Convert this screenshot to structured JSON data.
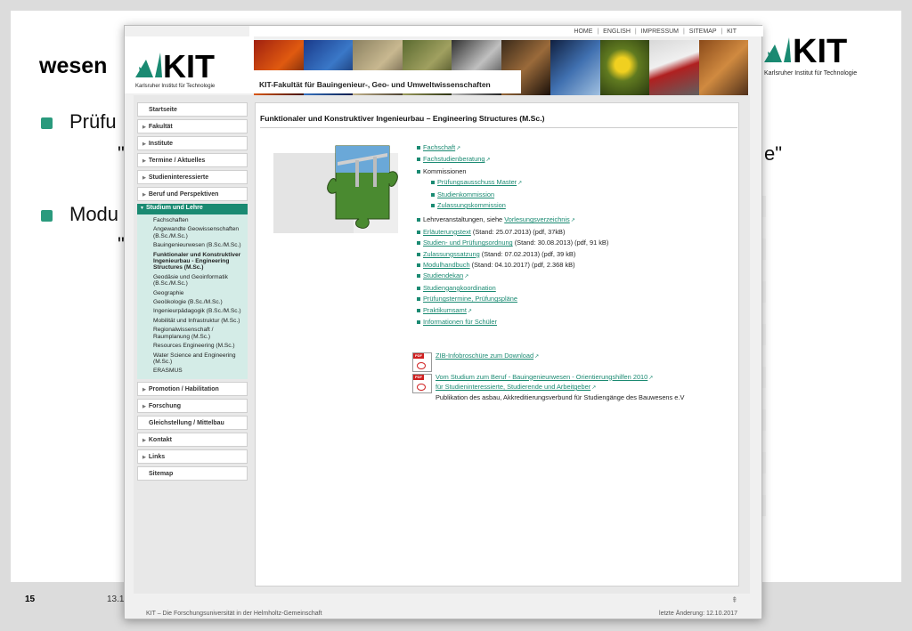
{
  "slide": {
    "title": "wesen",
    "bullet1": "Prüfu",
    "bullet1_cont": "\"",
    "bullet1_tail": "e\"",
    "bullet2": "Modu",
    "bullet2_cont": "\"",
    "page": "15",
    "date": "13.1",
    "logo_text": "KIT",
    "logo_sub": "Karlsruher Institut für Technologie"
  },
  "browser": {
    "topnav": [
      "HOME",
      "ENGLISH",
      "IMPRESSUM",
      "SITEMAP",
      "KIT"
    ],
    "logo_text": "KIT",
    "logo_sub": "Karlsruher Institut für Technologie",
    "faculty": "KIT-Fakultät für Bauingenieur-, Geo- und Umweltwissenschaften",
    "footer_left": "KIT – Die Forschungsuniversität in der Helmholtz-Gemeinschaft",
    "footer_right": "letzte Änderung: 12.10.2017"
  },
  "sidebar": {
    "items": [
      {
        "label": "Startseite",
        "arrow": false
      },
      {
        "label": "Fakultät",
        "arrow": true
      },
      {
        "label": "Institute",
        "arrow": true
      },
      {
        "label": "Termine / Aktuelles",
        "arrow": true
      },
      {
        "label": "Studieninteressierte",
        "arrow": true
      },
      {
        "label": "Beruf und Perspektiven",
        "arrow": true
      }
    ],
    "active": "Studium und Lehre",
    "sub_items": [
      "Fachschaften",
      "Angewandte Geowissenschaften (B.Sc./M.Sc.)",
      "Bauingenieurwesen (B.Sc./M.Sc.)",
      "Funktionaler und Konstruktiver Ingenieurbau - Engineering Structures (M.Sc.)",
      "Geodäsie und Geoinformatik (B.Sc./M.Sc.)",
      "Geographie",
      "Geoökologie (B.Sc./M.Sc.)",
      "Ingenieurpädagogik (B.Sc./M.Sc.)",
      "Mobilität und Infrastruktur (M.Sc.)",
      "Regionalwissenschaft / Raumplanung (M.Sc.)",
      "Resources Engineering (M.Sc.)",
      "Water Science and Engineering (M.Sc.)",
      "ERASMUS"
    ],
    "items_after": [
      {
        "label": "Promotion / Habilitation",
        "arrow": true
      },
      {
        "label": "Forschung",
        "arrow": true
      },
      {
        "label": "Gleichstellung / Mittelbau",
        "arrow": false
      },
      {
        "label": "Kontakt",
        "arrow": true
      },
      {
        "label": "Links",
        "arrow": true
      },
      {
        "label": "Sitemap",
        "arrow": false
      }
    ]
  },
  "main": {
    "title": "Funktionaler und Konstruktiver Ingenieurbau – Engineering Structures (M.Sc.)",
    "links": [
      {
        "parts": [
          {
            "t": "Fachschaft",
            "link": true
          }
        ],
        "ext": true
      },
      {
        "parts": [
          {
            "t": "Fachstudienberatung",
            "link": true
          }
        ],
        "ext": true
      },
      {
        "parts": [
          {
            "t": "Kommissionen",
            "link": false
          }
        ],
        "ext": false
      },
      {
        "parts": [
          {
            "t": "Prüfungsausschuss Master",
            "link": true
          }
        ],
        "ext": true,
        "sub": true
      },
      {
        "parts": [
          {
            "t": "Studienkommission",
            "link": true
          }
        ],
        "ext": false,
        "sub": true
      },
      {
        "parts": [
          {
            "t": "Zulassungskommission",
            "link": true
          }
        ],
        "ext": false,
        "sub": true
      },
      {
        "parts": [
          {
            "t": "Lehrveranstaltungen, siehe ",
            "link": false
          },
          {
            "t": "Vorlesungsverzeichnis",
            "link": true
          }
        ],
        "ext": true,
        "gap": true
      },
      {
        "parts": [
          {
            "t": "Erläuterungstext",
            "link": true
          },
          {
            "t": " (Stand: 25.07.2013) (pdf, 37kB)",
            "link": false
          }
        ],
        "ext": false
      },
      {
        "parts": [
          {
            "t": "Studien- und Prüfungsordnung",
            "link": true
          },
          {
            "t": " (Stand: 30.08.2013) (pdf, 91 kB)",
            "link": false
          }
        ],
        "ext": false
      },
      {
        "parts": [
          {
            "t": "Zulassungssatzung",
            "link": true
          },
          {
            "t": " (Stand: 07.02.2013) (pdf, 39 kB)",
            "link": false
          }
        ],
        "ext": false
      },
      {
        "parts": [
          {
            "t": "Modulhandbuch",
            "link": true
          },
          {
            "t": " (Stand: 04.10.2017) (pdf, 2.368 kB)",
            "link": false
          }
        ],
        "ext": false
      },
      {
        "parts": [
          {
            "t": "Studiendekan",
            "link": true
          }
        ],
        "ext": true
      },
      {
        "parts": [
          {
            "t": "Studiengangkoordination",
            "link": true
          }
        ],
        "ext": false
      },
      {
        "parts": [
          {
            "t": "Prüfungstermine, Prüfungspläne",
            "link": true
          }
        ],
        "ext": false
      },
      {
        "parts": [
          {
            "t": "Praktikumsamt",
            "link": true
          }
        ],
        "ext": true
      },
      {
        "parts": [
          {
            "t": "Informationen für Schüler",
            "link": true
          }
        ],
        "ext": false
      }
    ],
    "pdf1": "ZIB-Infobroschüre zum Download",
    "pdf2_line1": "Vom Studium zum Beruf - Bauingenieurwesen - Orientierungshilfen 2010",
    "pdf2_line2": "für Studieninteressierte, Studierende und Arbeitgeber",
    "pdf2_text": "Publikation des asbau, Akkreditierungsverbund für Studiengänge des Bauwesens e.V",
    "pdf_label": "PDF"
  },
  "colors": {
    "accent": "#1a8a72",
    "subnav_bg": "#d4ece7",
    "bullet": "#2a9a7d"
  }
}
